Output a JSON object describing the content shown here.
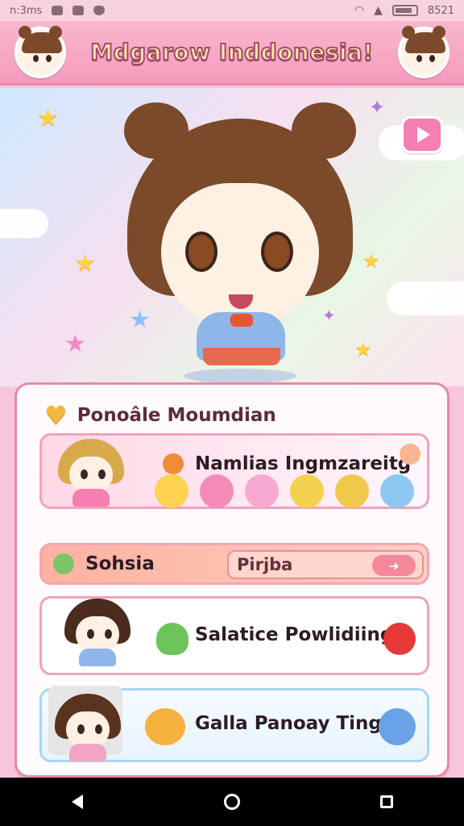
{
  "status_bar": {
    "time": "n:3ms",
    "clock": "8521",
    "icons": [
      "image-icon",
      "camera-icon",
      "shield-icon",
      "wifi-icon",
      "signal-icon",
      "battery-icon"
    ]
  },
  "header": {
    "title": "Mdgarow Inddonesia!"
  },
  "hero": {
    "video_button_icon": "play-icon"
  },
  "panel": {
    "title": "Ponoâle Moumdian",
    "title_icon": "heart-icon",
    "cards": [
      {
        "label": "Namlias Ingmzareitg"
      },
      {
        "label": "Sohsia",
        "input_value": "Pirjba",
        "button_icon": "arrow-right-icon"
      },
      {
        "label": "Salatice Powlidiing"
      },
      {
        "label": "Galla Panoay Ting"
      }
    ]
  },
  "nav": {
    "back_icon": "back-icon",
    "home_icon": "home-icon",
    "recent_icon": "recent-apps-icon"
  },
  "colors": {
    "accent_pink": "#f47fb0",
    "header_pink": "#f59bbd",
    "title_yellow": "#ffe7a8",
    "card_blue_border": "#a8d6f3"
  }
}
